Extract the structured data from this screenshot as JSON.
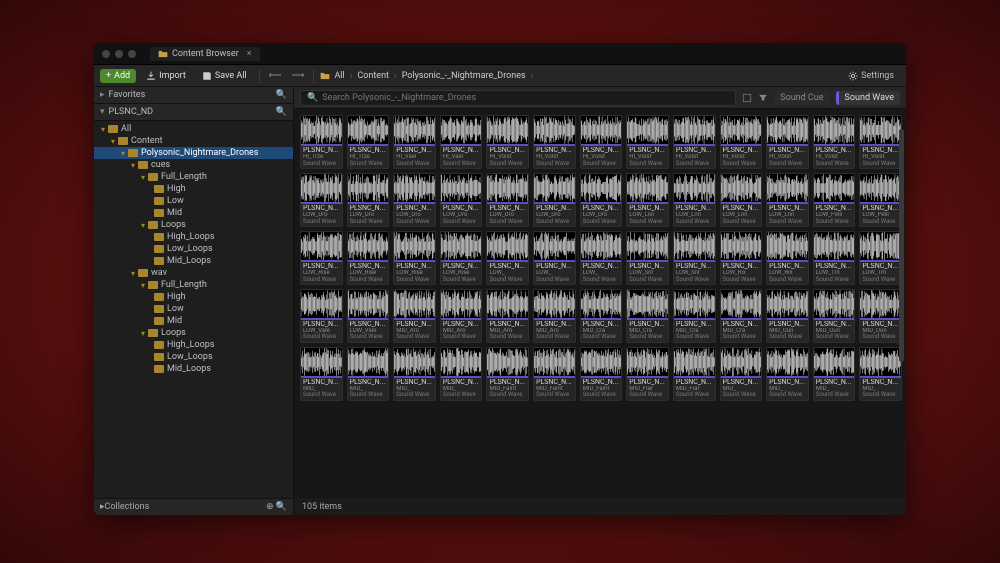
{
  "titlebar": {
    "tab_label": "Content Browser"
  },
  "toolbar": {
    "add": "Add",
    "import": "Import",
    "save_all": "Save All",
    "settings": "Settings"
  },
  "breadcrumb": [
    "All",
    "Content",
    "Polysonic_-_Nightmare_Drones"
  ],
  "sidebar": {
    "favorites": "Favorites",
    "project_abbr": "PLSNC_ND",
    "collections": "Collections",
    "tree": [
      {
        "d": 0,
        "open": true,
        "l": "All"
      },
      {
        "d": 1,
        "open": true,
        "l": "Content"
      },
      {
        "d": 2,
        "open": true,
        "l": "Polysonic_Nightmare_Drones",
        "sel": true
      },
      {
        "d": 3,
        "open": true,
        "l": "cues"
      },
      {
        "d": 4,
        "open": true,
        "l": "Full_Length"
      },
      {
        "d": 5,
        "open": false,
        "l": "High"
      },
      {
        "d": 5,
        "open": false,
        "l": "Low"
      },
      {
        "d": 5,
        "open": false,
        "l": "Mid"
      },
      {
        "d": 4,
        "open": true,
        "l": "Loops"
      },
      {
        "d": 5,
        "open": false,
        "l": "High_Loops"
      },
      {
        "d": 5,
        "open": false,
        "l": "Low_Loops"
      },
      {
        "d": 5,
        "open": false,
        "l": "Mid_Loops"
      },
      {
        "d": 3,
        "open": true,
        "l": "wav"
      },
      {
        "d": 4,
        "open": true,
        "l": "Full_Length"
      },
      {
        "d": 5,
        "open": false,
        "l": "High"
      },
      {
        "d": 5,
        "open": false,
        "l": "Low"
      },
      {
        "d": 5,
        "open": false,
        "l": "Mid"
      },
      {
        "d": 4,
        "open": true,
        "l": "Loops"
      },
      {
        "d": 5,
        "open": false,
        "l": "High_Loops"
      },
      {
        "d": 5,
        "open": false,
        "l": "Low_Loops"
      },
      {
        "d": 5,
        "open": false,
        "l": "Mid_Loops"
      }
    ]
  },
  "filter": {
    "search_placeholder": "Search Polysonic_-_Nightmare_Drones",
    "cue": "Sound Cue",
    "wave": "Sound Wave"
  },
  "assets": {
    "title": "PLSNC_N...",
    "type": "Sound Wave",
    "rows": [
      [
        "HI_Trze",
        "HI_Trze",
        "HI_Vael",
        "HI_Vael",
        "HI_Volst",
        "HI_Volst",
        "HI_Volst",
        "HI_Volst",
        "HI_Volst",
        "HI_Volst",
        "HI_Volst",
        "HI_Volst",
        "HI_Volst"
      ],
      [
        "LOW_Dro",
        "LOW_Dro",
        "LOW_Dro",
        "LOW_Dro",
        "LOW_Dro",
        "LOW_Dro",
        "LOW_Dro",
        "LOW_Lnn",
        "LOW_Lnn",
        "LOW_Lnn",
        "LOW_Lnn",
        "LOW_Pelli",
        "LOW_Pelli"
      ],
      [
        "LOW_Rise",
        "LOW_Rise",
        "LOW_Rise",
        "LOW_Rise",
        "LOW_",
        "LOW_",
        "LOW_",
        "LOW_Snr",
        "LOW_Snr",
        "LOW_Rix",
        "LOW_Rix",
        "LOW_Trn",
        "LOW_Trn"
      ],
      [
        "LOW_Vale",
        "LOW_Vale",
        "MID_Aro",
        "MID_Aro",
        "MID_Aro",
        "MID_Aro",
        "MID_Cra",
        "MID_Cra",
        "MID_Cra",
        "MID_Cra",
        "MID_Oun",
        "MID_Oun",
        "MID_Oun"
      ],
      [
        "MID_",
        "MID_",
        "MID_",
        "MID_",
        "MID_Faint",
        "MID_Faint",
        "MID_Faint",
        "MID_Flar",
        "MID_Flar",
        "MID_",
        "MID_",
        "MID_",
        "MID_"
      ]
    ]
  },
  "status": {
    "count": "105 items"
  }
}
